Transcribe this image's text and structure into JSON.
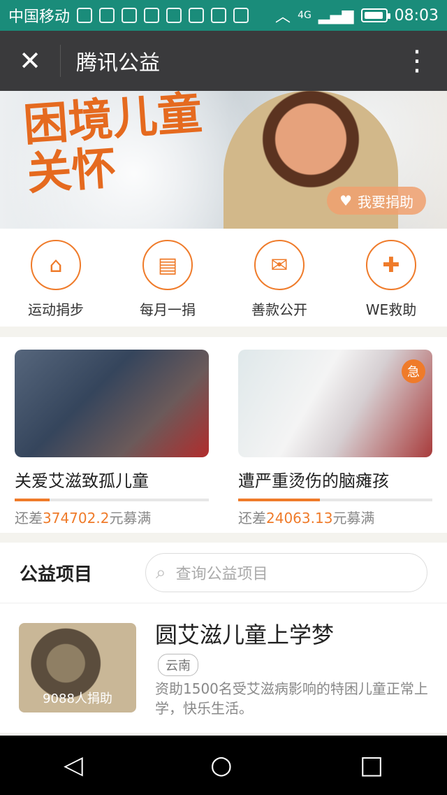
{
  "status_bar": {
    "carrier": "中国移动",
    "time": "08:03",
    "network": "4G"
  },
  "title_bar": {
    "title": "腾讯公益"
  },
  "banner": {
    "headline_line1": "困境儿童",
    "headline_line2": "关怀",
    "donate_label": "我要捐助"
  },
  "quick_entries": [
    {
      "label": "运动捐步",
      "icon": "shoe-icon"
    },
    {
      "label": "每月一捐",
      "icon": "calendar-icon"
    },
    {
      "label": "善款公开",
      "icon": "mail-icon"
    },
    {
      "label": "WE救助",
      "icon": "medkit-icon"
    }
  ],
  "featured": [
    {
      "title": "关爱艾滋致孤儿童",
      "remain_prefix": "还差",
      "amount": "374702.2",
      "remain_suffix": "元募满",
      "progress": 0.18
    },
    {
      "title": "遭严重烫伤的脑瘫孩",
      "remain_prefix": "还差",
      "amount": "24063.13",
      "remain_suffix": "元募满",
      "progress": 0.42,
      "badge": "急"
    }
  ],
  "projects": {
    "label": "公益项目",
    "search_placeholder": "查询公益项目",
    "items": [
      {
        "title": "圆艾滋儿童上学梦",
        "tag": "云南",
        "donors": "9088人捐助",
        "desc": "资助1500名受艾滋病影响的特困儿童正常上学，快乐生活。"
      }
    ]
  },
  "nav": {
    "back": "◁",
    "home": "○",
    "recent": "□"
  }
}
